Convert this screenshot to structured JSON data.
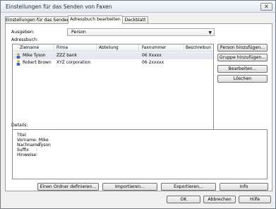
{
  "window": {
    "title": "Einstellungen für das Senden von Faxen",
    "close_glyph": "✕"
  },
  "tabs": [
    {
      "label": "Einstellungen für das Senden"
    },
    {
      "label": "Adressbuch bearbeiten"
    },
    {
      "label": "Deckblatt"
    }
  ],
  "ausgeben": {
    "label": "Ausgeben:",
    "value": "Person",
    "arrow": "▼"
  },
  "adressbuch": {
    "label": "Adressbuch:"
  },
  "columns": [
    "Zielname",
    "Firma",
    "Abteilung",
    "Faxnummer",
    "Beschreibun"
  ],
  "rows": [
    {
      "name": "Mike Tyson",
      "company": "ZZZ bank",
      "dept": "",
      "fax": "06 Xxxxx",
      "desc": "",
      "icon": "person-icon"
    },
    {
      "name": "Robert Brown",
      "company": "XYZ corporation",
      "dept": "",
      "fax": "06 2xxxxx",
      "desc": "",
      "icon": "person-icon"
    }
  ],
  "scrollbar": {
    "left_arrow": "◄",
    "right_arrow": "►",
    "grip": "|||"
  },
  "side_buttons": {
    "add_person": "Person hinzufügen...",
    "add_group": "Gruppe hinzufügen...",
    "edit": "Bearbeiten...",
    "delete": "Löschen"
  },
  "details": {
    "label": "Details:",
    "fields": [
      {
        "label": "Titel",
        "value": ""
      },
      {
        "label": "Vorname",
        "value": ": Mike"
      },
      {
        "label": "Nachname",
        "value": ": Tyson"
      },
      {
        "label": "Suffix",
        "value": ":"
      },
      {
        "label": "Hinweise",
        "value": ":"
      }
    ]
  },
  "bottom_buttons": {
    "define_folder": "Einen Ordner definieren...",
    "import": "Importieren...",
    "export": "Exportieren...",
    "info": "Info"
  },
  "dialog_buttons": {
    "ok": "OK",
    "cancel": "Abbrechen",
    "help": "Hilfe"
  }
}
